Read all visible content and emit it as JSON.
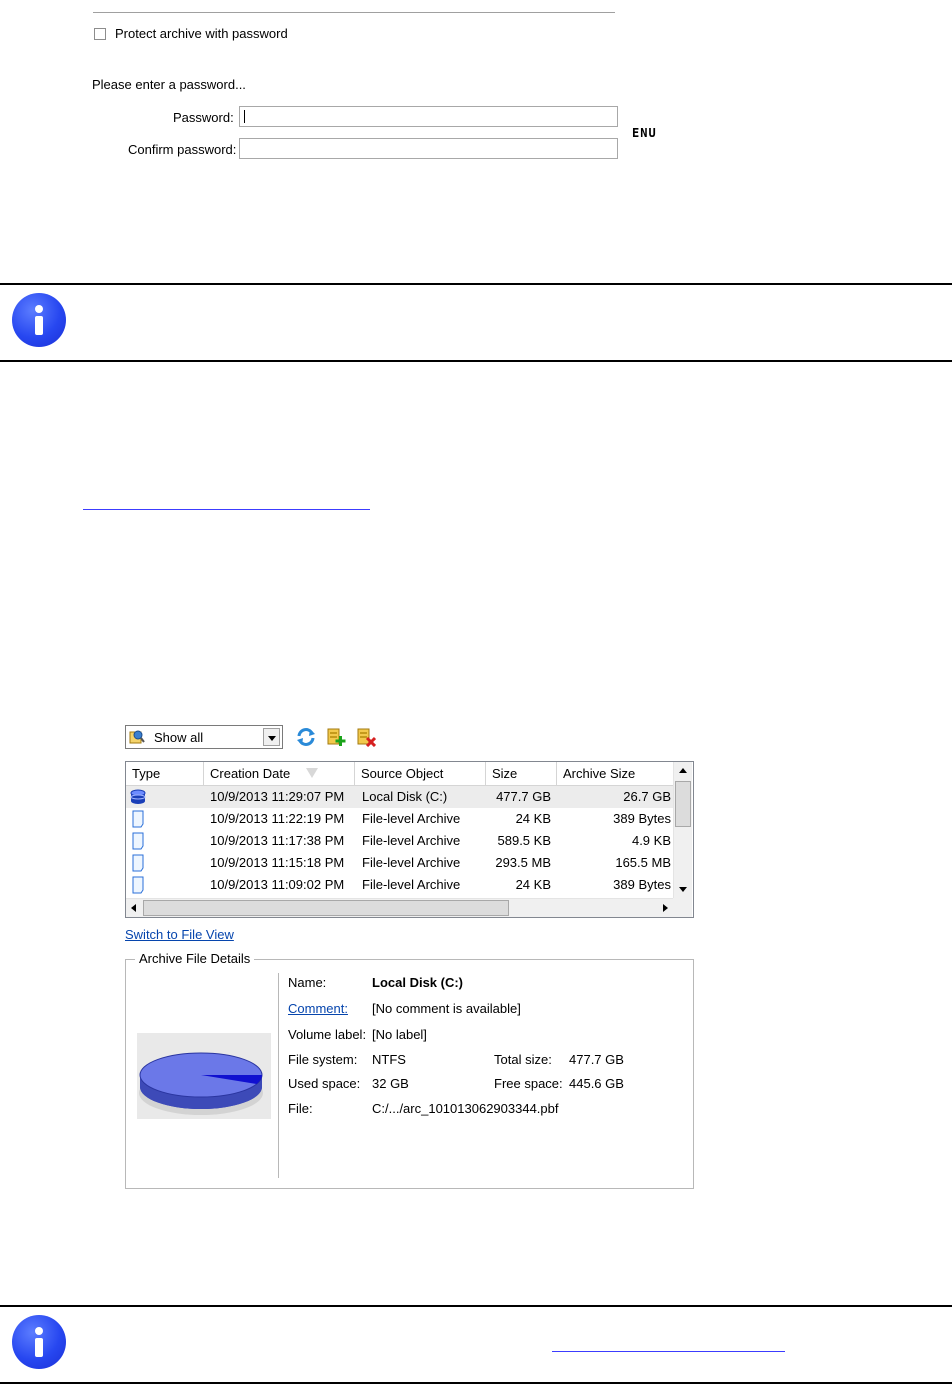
{
  "password_panel": {
    "protect_checkbox_label": "Protect archive with password",
    "protect_checked": false,
    "prompt": "Please enter a password...",
    "password_label": "Password:",
    "password_value": "",
    "confirm_label": "Confirm password:",
    "confirm_value": "",
    "keyboard_layout": "ENU"
  },
  "archive_browser": {
    "filter": {
      "selected": "Show all"
    },
    "toolbar": [
      "refresh-icon",
      "add-archive-icon",
      "delete-archive-icon"
    ],
    "columns": [
      "Type",
      "Creation Date",
      "Source Object",
      "Size",
      "Archive Size"
    ],
    "sorted_column": "Creation Date",
    "rows": [
      {
        "type_icon": "disk-archive-icon",
        "date": "10/9/2013 11:29:07 PM",
        "source": "Local Disk (C:)",
        "size": "477.7 GB",
        "archive_size": "26.7 GB",
        "selected": true
      },
      {
        "type_icon": "file-archive-icon",
        "date": "10/9/2013 11:22:19 PM",
        "source": "File-level Archive",
        "size": "24 KB",
        "archive_size": "389 Bytes",
        "selected": false
      },
      {
        "type_icon": "file-archive-icon",
        "date": "10/9/2013 11:17:38 PM",
        "source": "File-level Archive",
        "size": "589.5 KB",
        "archive_size": "4.9 KB",
        "selected": false
      },
      {
        "type_icon": "file-archive-icon",
        "date": "10/9/2013 11:15:18 PM",
        "source": "File-level Archive",
        "size": "293.5 MB",
        "archive_size": "165.5 MB",
        "selected": false
      },
      {
        "type_icon": "file-archive-icon",
        "date": "10/9/2013 11:09:02 PM",
        "source": "File-level Archive",
        "size": "24 KB",
        "archive_size": "389 Bytes",
        "selected": false
      }
    ],
    "switch_link": "Switch to File View"
  },
  "details": {
    "group_title": "Archive File Details",
    "name_label": "Name:",
    "name_value": "Local Disk (C:)",
    "comment_label": "Comment:",
    "comment_value": "[No comment is available]",
    "volume_label": "Volume label:",
    "volume_value": "[No label]",
    "fs_label": "File system:",
    "fs_value": "NTFS",
    "total_label": "Total size:",
    "total_value": "477.7 GB",
    "used_label": "Used space:",
    "used_value": "32 GB",
    "free_label": "Free space:",
    "free_value": "445.6 GB",
    "file_label": "File:",
    "file_value": "C:/.../arc_101013062903344.pbf",
    "used_fraction": 0.067,
    "pie_colors": {
      "free": "#6b78e8",
      "used": "#1010d0"
    }
  },
  "colors": {
    "info_icon": "#2747f0",
    "link": "#0645ad"
  }
}
